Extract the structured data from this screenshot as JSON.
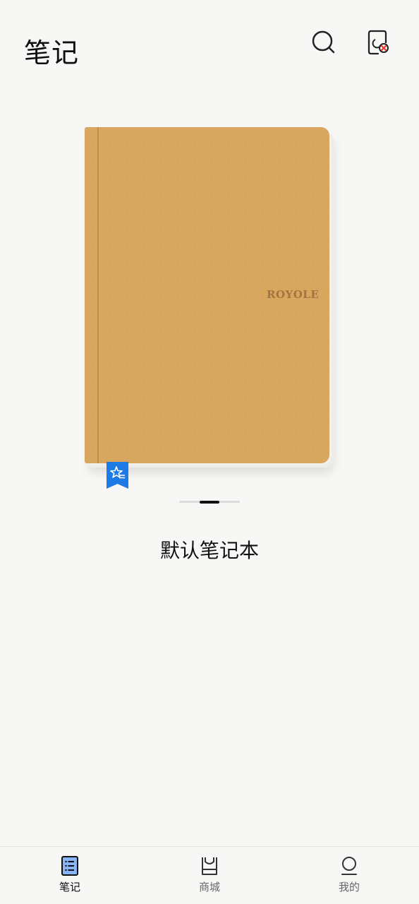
{
  "header": {
    "title": "笔记",
    "search_icon": "search-icon",
    "device_icon": "device-disconnected-icon"
  },
  "notebook": {
    "brand": "ROYOLE",
    "name": "默认笔记本",
    "cover_color": "#d9a65e",
    "bookmark_color": "#1e7be6",
    "bookmark_icon": "star-list-icon"
  },
  "pager": {
    "total": 1,
    "current": 1
  },
  "bottom_nav": {
    "items": [
      {
        "label": "笔记",
        "icon": "notes-icon",
        "active": true
      },
      {
        "label": "商城",
        "icon": "store-icon",
        "active": false
      },
      {
        "label": "我的",
        "icon": "profile-icon",
        "active": false
      }
    ]
  }
}
